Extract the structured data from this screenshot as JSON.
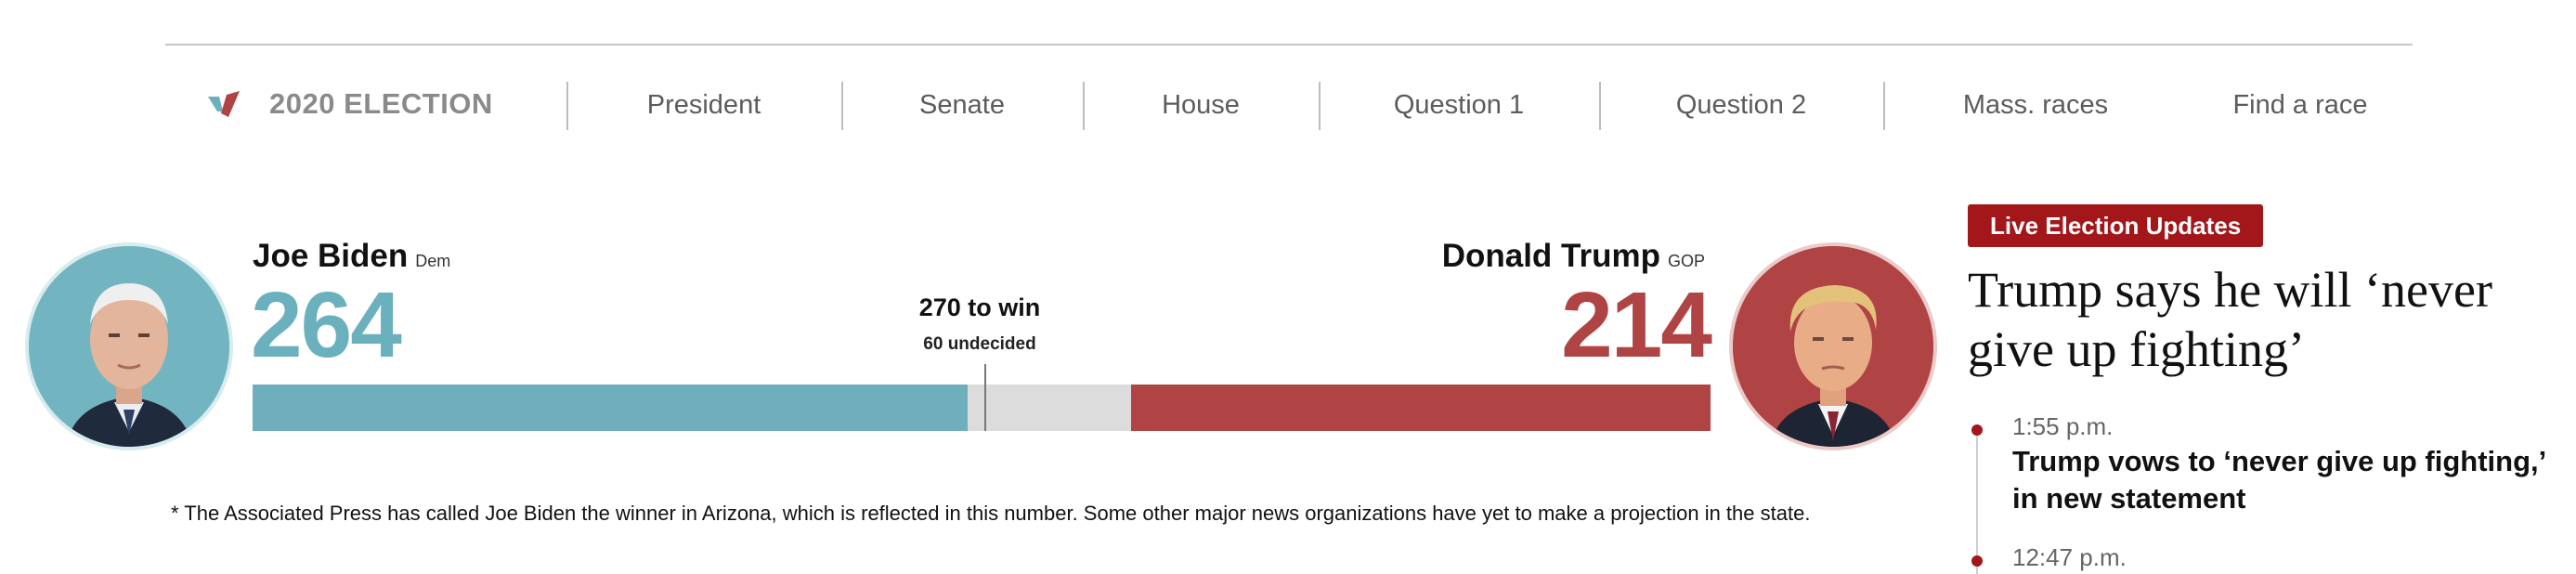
{
  "nav": {
    "brand_label": "2020 ELECTION",
    "items": [
      {
        "label": "President"
      },
      {
        "label": "Senate"
      },
      {
        "label": "House"
      },
      {
        "label": "Question 1"
      },
      {
        "label": "Question 2"
      },
      {
        "label": "Mass. races"
      },
      {
        "label": "Find a race"
      }
    ]
  },
  "race": {
    "dem": {
      "name": "Joe Biden",
      "party": "Dem",
      "votes": "264",
      "color": "#6eafbb"
    },
    "gop": {
      "name": "Donald Trump",
      "party": "GOP",
      "votes": "214",
      "color": "#b04343"
    },
    "to_win": "270 to win",
    "undecided": "60 undecided",
    "total_electoral_votes": 538,
    "threshold": 270
  },
  "footnote": "* The Associated Press has called Joe Biden the winner in Arizona, which is reflected in this number. Some other major news organizations have yet to make a projection in the state.",
  "live": {
    "badge": "Live Election Updates",
    "headline": "Trump says he will ‘never give up fighting’",
    "items": [
      {
        "time": "1:55 p.m.",
        "text": "Trump vows to ‘never give up fighting,’ in new statement"
      },
      {
        "time": "12:47 p.m.",
        "text": ""
      }
    ]
  }
}
